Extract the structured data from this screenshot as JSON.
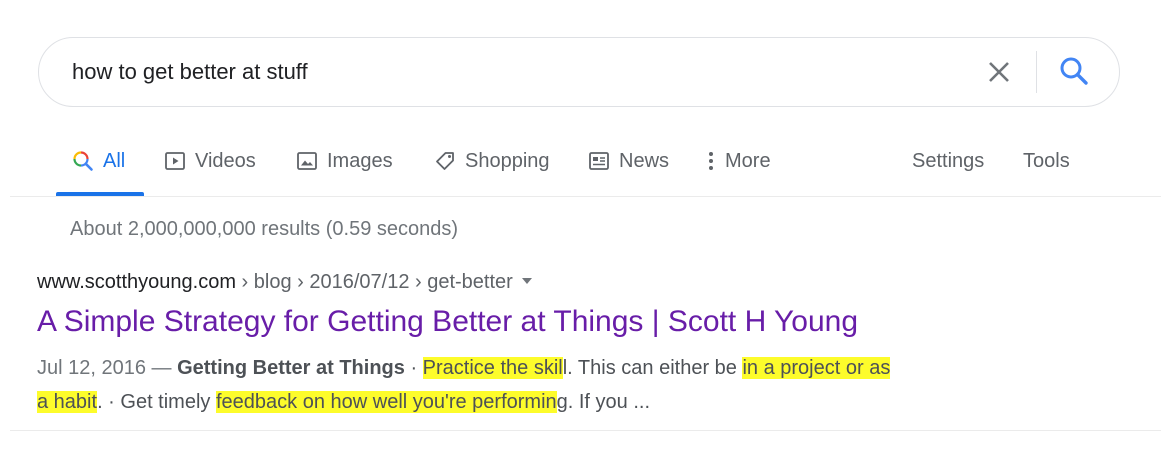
{
  "search": {
    "query": "how to get better at stuff",
    "icons": {
      "clear": "close-icon",
      "search": "magnifier-icon"
    },
    "colors": {
      "search_icon": "#4285f4",
      "clear_icon": "#70757a"
    }
  },
  "tabs": {
    "all": {
      "label": "All",
      "icon": "search-icon",
      "active": true
    },
    "videos": {
      "label": "Videos",
      "icon": "play-icon"
    },
    "images": {
      "label": "Images",
      "icon": "image-icon"
    },
    "shopping": {
      "label": "Shopping",
      "icon": "tag-icon"
    },
    "news": {
      "label": "News",
      "icon": "newspaper-icon"
    },
    "more": {
      "label": "More",
      "icon": "more-vert-icon"
    },
    "settings": {
      "label": "Settings"
    },
    "tools": {
      "label": "Tools"
    },
    "active_color": "#1a73e8"
  },
  "stats": {
    "text": "About 2,000,000,000 results (0.59 seconds)"
  },
  "result": {
    "domain": "www.scotthyoung.com",
    "breadcrumbs": " › blog › 2016/07/12 › get-better",
    "title": "A Simple Strategy for Getting Better at Things | Scott H Young",
    "title_color": "#681da8",
    "snippet": {
      "date": "Jul 12, 2016 — ",
      "bold": "Getting Better at Things",
      "sep1": " · ",
      "hl1": "Practice the skil",
      "t1": "l. This can either be ",
      "hl2": "in a project or as",
      "t2": " ",
      "hl3": "a habit",
      "t3": ". · Get timely ",
      "hl4": "feedback on how well you're performin",
      "t4": "g. If you ..."
    },
    "highlight_color": "#fdfc2b"
  }
}
